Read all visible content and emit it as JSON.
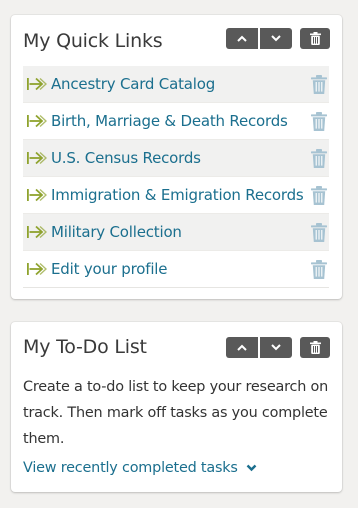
{
  "colors": {
    "link": "#1b6f8e",
    "link_icon": "#8fa32e",
    "row_trash": "#a7c3d2",
    "control_bg": "#595959",
    "page_bg": "#f2f1ef"
  },
  "quick_links": {
    "title": "My Quick Links",
    "controls": [
      "chevron-up-icon",
      "chevron-down-icon",
      "trash-icon"
    ],
    "items": [
      {
        "label": "Ancestry Card Catalog",
        "icon": "link-arrow-icon"
      },
      {
        "label": "Birth, Marriage & Death Records",
        "icon": "link-arrow-icon"
      },
      {
        "label": "U.S. Census Records",
        "icon": "link-arrow-icon"
      },
      {
        "label": "Immigration & Emigration Records",
        "icon": "link-arrow-icon"
      },
      {
        "label": "Military Collection",
        "icon": "link-arrow-icon"
      },
      {
        "label": "Edit your profile",
        "icon": "link-arrow-icon"
      }
    ]
  },
  "todo": {
    "title": "My To-Do List",
    "controls": [
      "chevron-up-icon",
      "chevron-down-icon",
      "trash-icon"
    ],
    "description": "Create a to-do list to keep your research on track. Then mark off tasks as you complete them.",
    "completed_link": "View recently completed tasks"
  }
}
